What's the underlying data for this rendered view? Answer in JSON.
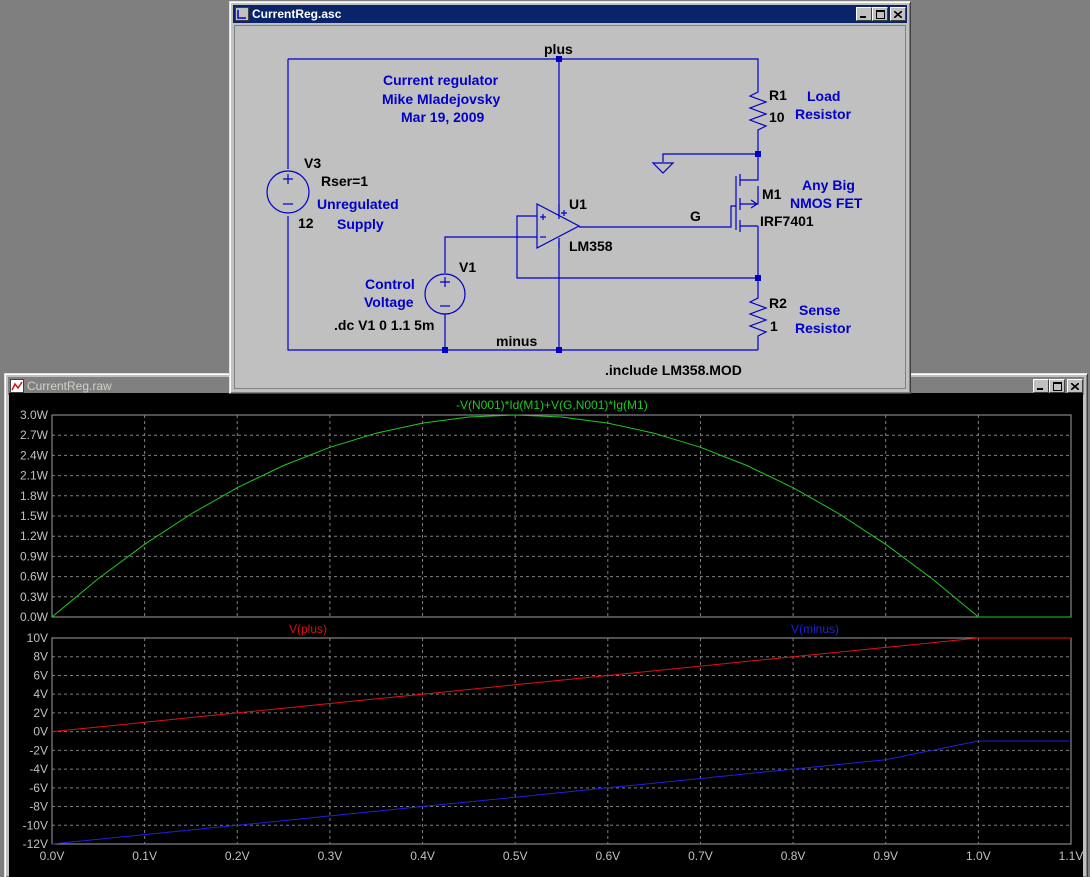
{
  "schematic": {
    "title": "CurrentReg.asc",
    "texts": {
      "net_plus": "plus",
      "net_minus": "minus",
      "net_g": "G",
      "comment1": "Current regulator",
      "comment2": "Mike Mladejovsky",
      "comment3": "Mar 19, 2009",
      "v3_name": "V3",
      "v3_rser": "Rser=1",
      "v3_value": "12",
      "v3_desc1": "Unregulated",
      "v3_desc2": "Supply",
      "r1_name": "R1",
      "r1_value": "10",
      "r1_desc1": "Load",
      "r1_desc2": "Resistor",
      "m1_name": "M1",
      "m1_model": "IRF7401",
      "m1_desc1": "Any Big",
      "m1_desc2": "NMOS FET",
      "u1_name": "U1",
      "u1_model": "LM358",
      "v1_name": "V1",
      "v1_desc1": "Control",
      "v1_desc2": "Voltage",
      "dc_directive": ".dc V1 0 1.1 5m",
      "r2_name": "R2",
      "r2_value": "1",
      "r2_desc1": "Sense",
      "r2_desc2": "Resistor",
      "include_directive": ".include LM358.MOD"
    }
  },
  "waveform": {
    "title": "CurrentReg.raw",
    "colors": {
      "power": "#22c822",
      "vplus": "#e01010",
      "vminus": "#2020e0",
      "grid": "#808080",
      "axis_text": "#c0c0c0"
    },
    "x_ticks": [
      "0.0V",
      "0.1V",
      "0.2V",
      "0.3V",
      "0.4V",
      "0.5V",
      "0.6V",
      "0.7V",
      "0.8V",
      "0.9V",
      "1.0V",
      "1.1V"
    ],
    "top_pane": {
      "trace_label": "-V(N001)*Id(M1)+V(G,N001)*Ig(M1)",
      "y_ticks": [
        "0.0W",
        "0.3W",
        "0.6W",
        "0.9W",
        "1.2W",
        "1.5W",
        "1.8W",
        "2.1W",
        "2.4W",
        "2.7W",
        "3.0W"
      ]
    },
    "bottom_pane": {
      "trace_label_plus": "V(plus)",
      "trace_label_minus": "V(minus)",
      "y_ticks": [
        "-12V",
        "-10V",
        "-8V",
        "-6V",
        "-4V",
        "-2V",
        "0V",
        "2V",
        "4V",
        "6V",
        "8V",
        "10V"
      ]
    }
  },
  "chart_data": [
    {
      "type": "line",
      "title": "",
      "xlabel": "",
      "ylabel": "",
      "xlim": [
        0,
        1.1
      ],
      "ylim": [
        0,
        3.0
      ],
      "series": [
        {
          "name": "-V(N001)*Id(M1)+V(G,N001)*Ig(M1)",
          "x": [
            0,
            0.05,
            0.1,
            0.15,
            0.2,
            0.25,
            0.3,
            0.35,
            0.4,
            0.45,
            0.5,
            0.55,
            0.6,
            0.65,
            0.7,
            0.75,
            0.8,
            0.85,
            0.9,
            0.95,
            1.0,
            1.05,
            1.1
          ],
          "values": [
            0.0,
            0.57,
            1.08,
            1.53,
            1.92,
            2.25,
            2.52,
            2.73,
            2.88,
            2.97,
            3.0,
            2.97,
            2.88,
            2.73,
            2.52,
            2.25,
            1.92,
            1.53,
            1.08,
            0.57,
            0.0,
            0.0,
            0.0
          ]
        }
      ]
    },
    {
      "type": "line",
      "title": "",
      "xlabel": "",
      "ylabel": "",
      "xlim": [
        0,
        1.1
      ],
      "ylim": [
        -12,
        10
      ],
      "series": [
        {
          "name": "V(plus)",
          "x": [
            0,
            0.1,
            0.2,
            0.3,
            0.4,
            0.5,
            0.6,
            0.7,
            0.8,
            0.9,
            1.0,
            1.1
          ],
          "values": [
            0,
            1,
            2,
            3,
            4,
            5,
            6,
            7,
            8,
            9,
            10,
            10
          ]
        },
        {
          "name": "V(minus)",
          "x": [
            0,
            0.1,
            0.2,
            0.3,
            0.4,
            0.5,
            0.6,
            0.7,
            0.8,
            0.9,
            1.0,
            1.1
          ],
          "values": [
            -12,
            -11,
            -10,
            -9,
            -8,
            -7,
            -6,
            -5,
            -4,
            -3,
            -1,
            -1
          ]
        }
      ]
    }
  ]
}
